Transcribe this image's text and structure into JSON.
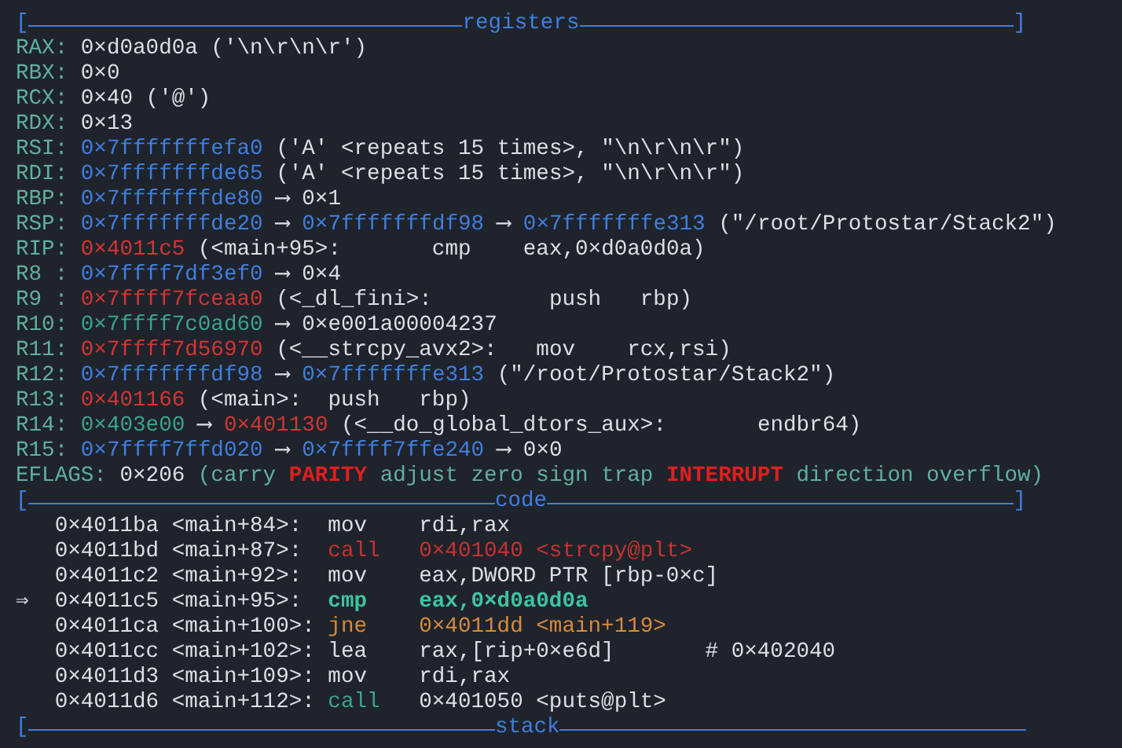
{
  "registers": {
    "header": {
      "left": "[",
      "title": "registers",
      "right": "]"
    },
    "lines": [
      [
        {
          "kind": "reg",
          "text": "RAX:"
        },
        {
          "kind": "val",
          "text": "0×d0a0d0a ('\\n\\r\\n\\r')"
        }
      ],
      [
        {
          "kind": "reg",
          "text": "RBX:"
        },
        {
          "kind": "val",
          "text": "0×0"
        }
      ],
      [
        {
          "kind": "reg",
          "text": "RCX:"
        },
        {
          "kind": "val",
          "text": "0×40 ('@')"
        }
      ],
      [
        {
          "kind": "reg",
          "text": "RDX:"
        },
        {
          "kind": "val",
          "text": "0×13"
        }
      ],
      [
        {
          "kind": "reg",
          "text": "RSI:"
        },
        {
          "kind": "stack",
          "text": "0×7fffffffefa0"
        },
        {
          "kind": "val",
          "text": "('A' <repeats 15 times>, \"\\n\\r\\n\\r\")"
        }
      ],
      [
        {
          "kind": "reg",
          "text": "RDI:"
        },
        {
          "kind": "stack",
          "text": "0×7fffffffde65"
        },
        {
          "kind": "val",
          "text": "('A' <repeats 15 times>, \"\\n\\r\\n\\r\")"
        }
      ],
      [
        {
          "kind": "reg",
          "text": "RBP:"
        },
        {
          "kind": "stack",
          "text": "0×7fffffffde80"
        },
        {
          "kind": "arrow",
          "text": "⟶"
        },
        {
          "kind": "val",
          "text": "0×1"
        }
      ],
      [
        {
          "kind": "reg",
          "text": "RSP:"
        },
        {
          "kind": "stack",
          "text": "0×7fffffffde20"
        },
        {
          "kind": "arrow",
          "text": "⟶"
        },
        {
          "kind": "stack",
          "text": "0×7fffffffdf98"
        },
        {
          "kind": "arrow",
          "text": "⟶"
        },
        {
          "kind": "stack",
          "text": "0×7fffffffe313"
        },
        {
          "kind": "val",
          "text": "(\"/root/Protostar/Stack2\")"
        }
      ],
      [
        {
          "kind": "reg",
          "text": "RIP:"
        },
        {
          "kind": "code",
          "text": "0×4011c5"
        },
        {
          "kind": "val",
          "text": "(<main+95>:       cmp    eax,0×d0a0d0a)"
        }
      ],
      [
        {
          "kind": "reg",
          "text": "R8 :"
        },
        {
          "kind": "stack",
          "text": "0×7ffff7df3ef0"
        },
        {
          "kind": "arrow",
          "text": "⟶"
        },
        {
          "kind": "val",
          "text": "0×4"
        }
      ],
      [
        {
          "kind": "reg",
          "text": "R9 :"
        },
        {
          "kind": "code",
          "text": "0×7ffff7fceaa0"
        },
        {
          "kind": "val",
          "text": "(<_dl_fini>:         push   rbp)"
        }
      ],
      [
        {
          "kind": "reg",
          "text": "R10:"
        },
        {
          "kind": "data",
          "text": "0×7ffff7c0ad60"
        },
        {
          "kind": "arrow",
          "text": "⟶"
        },
        {
          "kind": "val",
          "text": "0×e001a00004237"
        }
      ],
      [
        {
          "kind": "reg",
          "text": "R11:"
        },
        {
          "kind": "code",
          "text": "0×7ffff7d56970"
        },
        {
          "kind": "val",
          "text": "(<__strcpy_avx2>:   mov    rcx,rsi)"
        }
      ],
      [
        {
          "kind": "reg",
          "text": "R12:"
        },
        {
          "kind": "stack",
          "text": "0×7fffffffdf98"
        },
        {
          "kind": "arrow",
          "text": "⟶"
        },
        {
          "kind": "stack",
          "text": "0×7fffffffe313"
        },
        {
          "kind": "val",
          "text": "(\"/root/Protostar/Stack2\")"
        }
      ],
      [
        {
          "kind": "reg",
          "text": "R13:"
        },
        {
          "kind": "code",
          "text": "0×401166"
        },
        {
          "kind": "val",
          "text": "(<main>:  push   rbp)"
        }
      ],
      [
        {
          "kind": "reg",
          "text": "R14:"
        },
        {
          "kind": "data",
          "text": "0×403e00"
        },
        {
          "kind": "arrow",
          "text": "⟶"
        },
        {
          "kind": "code",
          "text": "0×401130"
        },
        {
          "kind": "val",
          "text": "(<__do_global_dtors_aux>:       endbr64)"
        }
      ],
      [
        {
          "kind": "reg",
          "text": "R15:"
        },
        {
          "kind": "stack",
          "text": "0×7ffff7ffd020"
        },
        {
          "kind": "arrow",
          "text": "⟶"
        },
        {
          "kind": "stack",
          "text": "0×7ffff7ffe240"
        },
        {
          "kind": "arrow",
          "text": "⟶"
        },
        {
          "kind": "val",
          "text": "0×0"
        }
      ],
      [
        {
          "kind": "reg",
          "text": "EFLAGS:"
        },
        {
          "kind": "val",
          "text": "0×206"
        },
        {
          "kind": "flag",
          "text": "(carry"
        },
        {
          "kind": "flagset",
          "text": "PARITY"
        },
        {
          "kind": "flag",
          "text": "adjust zero sign trap"
        },
        {
          "kind": "flagset",
          "text": "INTERRUPT"
        },
        {
          "kind": "flag",
          "text": "direction overflow)"
        }
      ]
    ]
  },
  "code": {
    "header": {
      "left": "[",
      "title": "code",
      "right": "]"
    },
    "lines": [
      {
        "address": "0×4011ba",
        "symbol": "<main+84>:",
        "mnemonic": "mov",
        "operands": "rdi,rax",
        "kind": "plain",
        "current": false
      },
      {
        "address": "0×4011bd",
        "symbol": "<main+87>:",
        "mnemonic": "call",
        "operands": "0×401040 <strcpy@plt>",
        "kind": "call",
        "current": false
      },
      {
        "address": "0×4011c2",
        "symbol": "<main+92>:",
        "mnemonic": "mov",
        "operands": "eax,DWORD PTR [rbp-0×c]",
        "kind": "plain",
        "current": false
      },
      {
        "marker": "⇒",
        "address": "0×4011c5",
        "symbol": "<main+95>:",
        "mnemonic": "cmp",
        "operands": "eax,0×d0a0d0a",
        "kind": "plain",
        "current": true
      },
      {
        "address": "0×4011ca",
        "symbol": "<main+100>:",
        "mnemonic": "jne",
        "operands": "0×4011dd <main+119>",
        "kind": "branch",
        "current": false
      },
      {
        "address": "0×4011cc",
        "symbol": "<main+102>:",
        "mnemonic": "lea",
        "operands": "rax,[rip+0×e6d]",
        "comment": "# 0×402040",
        "kind": "plain",
        "current": false
      },
      {
        "address": "0×4011d3",
        "symbol": "<main+109>:",
        "mnemonic": "mov",
        "operands": "rdi,rax",
        "kind": "plain",
        "current": false
      },
      {
        "address": "0×4011d6",
        "symbol": "<main+112>:",
        "mnemonic": "call",
        "operands": "0×401050 <puts@plt>",
        "kind": "extcall",
        "current": false
      }
    ]
  },
  "stack": {
    "header": {
      "left": "[",
      "title": "stack"
    }
  }
}
